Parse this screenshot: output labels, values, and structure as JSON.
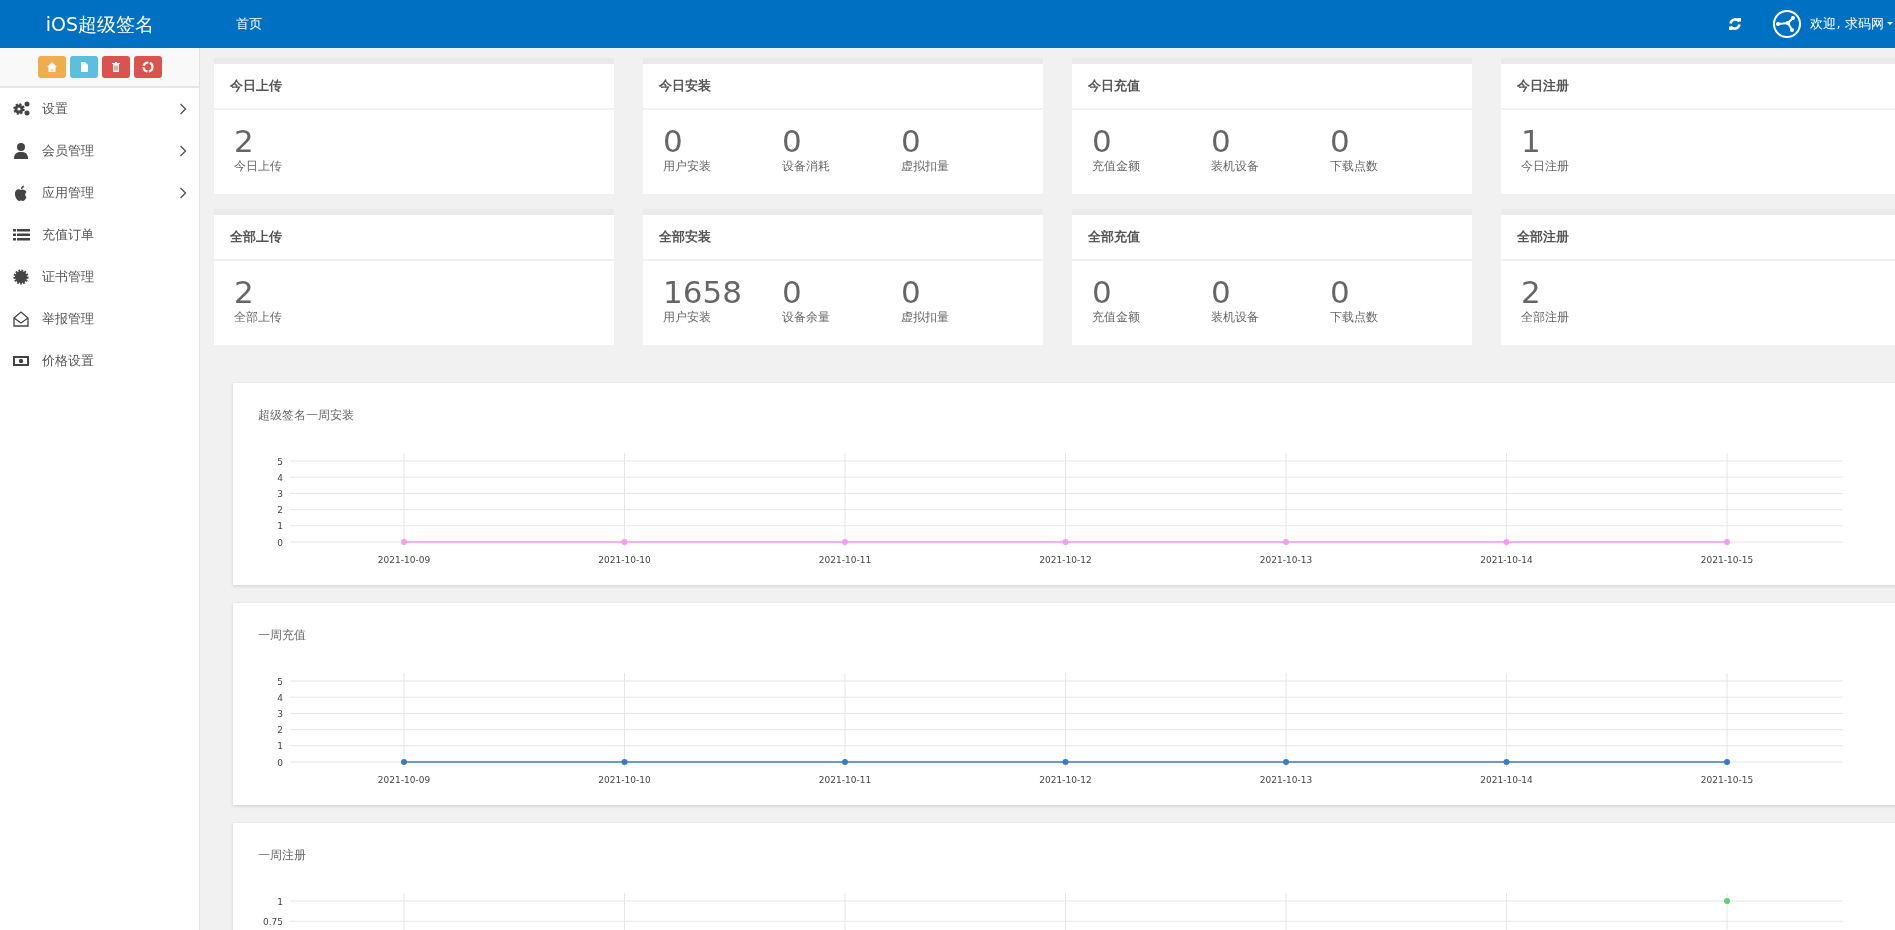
{
  "header": {
    "logo": "iOS超级签名",
    "nav": [
      {
        "label": "首页"
      }
    ],
    "greeting": "欢迎, 求码网"
  },
  "sidebar": {
    "toolbar": [
      {
        "kind": "home"
      },
      {
        "kind": "file"
      },
      {
        "kind": "trash"
      },
      {
        "kind": "recycle"
      }
    ],
    "menu": [
      {
        "label": "设置",
        "kind": "gears",
        "expandable": true
      },
      {
        "label": "会员管理",
        "kind": "user",
        "expandable": true
      },
      {
        "label": "应用管理",
        "kind": "apple",
        "expandable": true
      },
      {
        "label": "充值订单",
        "kind": "list",
        "expandable": false
      },
      {
        "label": "证书管理",
        "kind": "certificate",
        "expandable": false
      },
      {
        "label": "举报管理",
        "kind": "envelope",
        "expandable": false
      },
      {
        "label": "价格设置",
        "kind": "money",
        "expandable": false
      }
    ]
  },
  "stat_cards": [
    {
      "title": "今日上传",
      "items": [
        {
          "value": "2",
          "label": "今日上传"
        }
      ]
    },
    {
      "title": "今日安装",
      "items": [
        {
          "value": "0",
          "label": "用户安装"
        },
        {
          "value": "0",
          "label": "设备消耗"
        },
        {
          "value": "0",
          "label": "虚拟扣量"
        }
      ]
    },
    {
      "title": "今日充值",
      "items": [
        {
          "value": "0",
          "label": "充值金额"
        },
        {
          "value": "0",
          "label": "装机设备"
        },
        {
          "value": "0",
          "label": "下载点数"
        }
      ]
    },
    {
      "title": "今日注册",
      "items": [
        {
          "value": "1",
          "label": "今日注册"
        }
      ]
    },
    {
      "title": "全部上传",
      "items": [
        {
          "value": "2",
          "label": "全部上传"
        }
      ]
    },
    {
      "title": "全部安装",
      "items": [
        {
          "value": "1658",
          "label": "用户安装"
        },
        {
          "value": "0",
          "label": "设备余量"
        },
        {
          "value": "0",
          "label": "虚拟扣量"
        }
      ]
    },
    {
      "title": "全部充值",
      "items": [
        {
          "value": "0",
          "label": "充值金额"
        },
        {
          "value": "0",
          "label": "装机设备"
        },
        {
          "value": "0",
          "label": "下载点数"
        }
      ]
    },
    {
      "title": "全部注册",
      "items": [
        {
          "value": "2",
          "label": "全部注册"
        }
      ]
    }
  ],
  "charts": [
    {
      "title": "超级签名一周安装",
      "chart_data": {
        "type": "line",
        "categories": [
          "2021-10-09",
          "2021-10-10",
          "2021-10-11",
          "2021-10-12",
          "2021-10-13",
          "2021-10-14",
          "2021-10-15"
        ],
        "ylim": [
          0,
          5
        ],
        "yticks": [
          0,
          1,
          2,
          3,
          4,
          5
        ],
        "grid": true,
        "series": [
          {
            "color": "#f99bf0",
            "marker": true,
            "values": [
              0,
              0,
              0,
              0,
              0,
              0,
              0
            ]
          }
        ]
      }
    },
    {
      "title": "一周充值",
      "chart_data": {
        "type": "line",
        "categories": [
          "2021-10-09",
          "2021-10-10",
          "2021-10-11",
          "2021-10-12",
          "2021-10-13",
          "2021-10-14",
          "2021-10-15"
        ],
        "ylim": [
          0,
          5
        ],
        "yticks": [
          0,
          1,
          2,
          3,
          4,
          5
        ],
        "grid": true,
        "series": [
          {
            "color": "#3a7bc8",
            "marker": true,
            "values": [
              0,
              0,
              0,
              0,
              0,
              0,
              0
            ]
          }
        ]
      }
    },
    {
      "title": "一周注册",
      "chart_data": {
        "type": "line",
        "ylim": [
          0.75,
          1
        ],
        "yticks": [
          {
            "value": 0.75,
            "label": "0.75"
          },
          1
        ],
        "grid": true,
        "series": [
          {
            "color": "#5fd07a",
            "marker": true,
            "values": [
              null,
              null,
              null,
              null,
              null,
              null,
              1
            ]
          }
        ]
      }
    }
  ]
}
